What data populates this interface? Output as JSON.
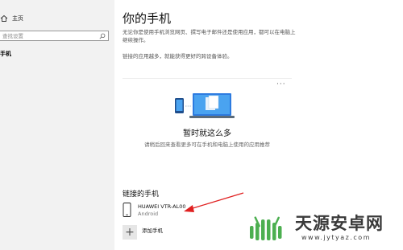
{
  "sidebar": {
    "home_label": "主页",
    "search_placeholder": "查找设置",
    "nav_item": "手机"
  },
  "main": {
    "title": "你的手机",
    "description": "无论你是使用手机浏览网页、撰写电子邮件还是使用应用，都可以在电脑上继续操作。",
    "description2": "链接的应用越多，就能获得更好的跨设备体验。",
    "more_label": "···",
    "empty_title": "暂时就这么多",
    "empty_desc": "请稍后回来查看更多可在手机和电脑上使用的应用推荐",
    "linked_section_title": "链接的手机",
    "phone_name": "HUAWEI VTR-AL00",
    "phone_os": "Android",
    "add_plus": "+",
    "add_phone_label": "添加手机"
  },
  "watermark": {
    "title": "天源安卓网",
    "url": "www.jytyaz.com"
  },
  "colors": {
    "sidebar_bg": "#f2f2f2",
    "accent_blue": "#1e88e5",
    "arrow_red": "#e02020",
    "watermark_green": "#4caf50"
  },
  "icons": [
    "home-icon",
    "search-icon",
    "more-icon",
    "illustration",
    "phone-icon",
    "add-icon",
    "arrow-annotation",
    "watermark-logo"
  ]
}
